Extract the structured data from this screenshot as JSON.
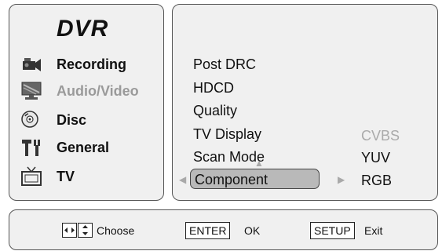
{
  "sidebar": {
    "brand": "DVR",
    "items": [
      {
        "label": "Recording",
        "icon": "camera-icon"
      },
      {
        "label": "Audio/Video",
        "icon": "monitor-icon"
      },
      {
        "label": "Disc",
        "icon": "disc-icon"
      },
      {
        "label": "General",
        "icon": "tools-icon"
      },
      {
        "label": "TV",
        "icon": "tv-icon"
      }
    ]
  },
  "menu": {
    "items": [
      "Post DRC",
      "HDCD",
      "Quality",
      "TV Display",
      "Scan Mode",
      "Component"
    ],
    "selected": "Component",
    "options": [
      "CVBS",
      "YUV",
      "RGB"
    ],
    "disabled_options": [
      "CVBS"
    ]
  },
  "footer": {
    "choose_label": "Choose",
    "enter_key": "ENTER",
    "enter_label": "OK",
    "setup_key": "SETUP",
    "setup_label": "Exit"
  },
  "colors": {
    "panel_bg": "#f0f0f0",
    "selected_bg": "#b9b9b9",
    "inactive_text": "#9a9a9a"
  }
}
